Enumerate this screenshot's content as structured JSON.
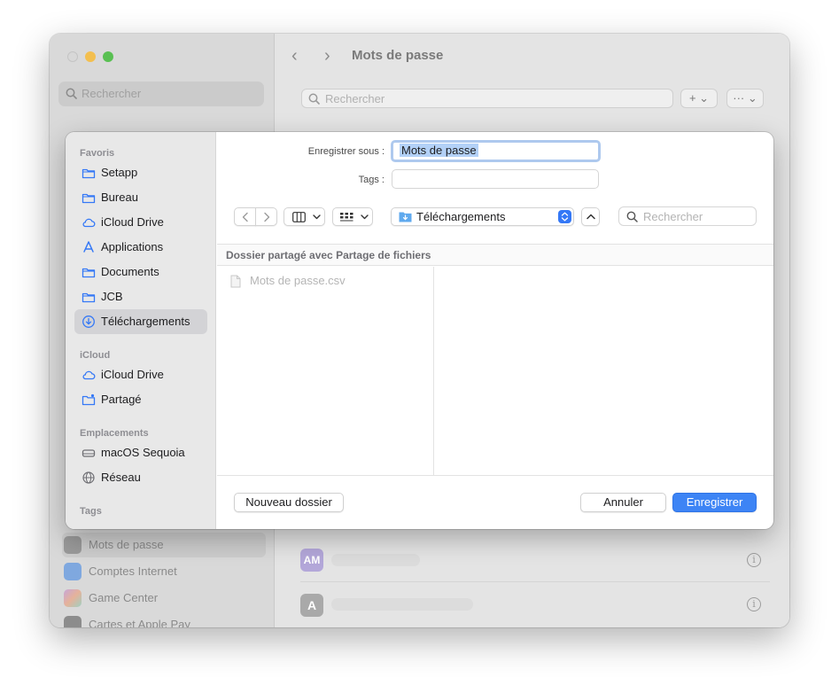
{
  "background_window": {
    "sidebar_search_placeholder": "Rechercher",
    "title": "Mots de passe",
    "toolbar_search_placeholder": "Rechercher",
    "add_button": "+ ⌄",
    "more_button": "··· ⌄",
    "sidebar_items": [
      {
        "label": "Mots de passe",
        "icon": "key-icon"
      },
      {
        "label": "Comptes Internet",
        "icon": "at-icon"
      },
      {
        "label": "Game Center",
        "icon": "game-center-icon"
      },
      {
        "label": "Cartes et Apple Pay",
        "icon": "wallet-icon"
      }
    ],
    "list_rows": [
      {
        "avatar": "AM"
      },
      {
        "avatar": "A"
      }
    ],
    "info_glyph": "i"
  },
  "sheet": {
    "save_as_label": "Enregistrer sous :",
    "save_as_value": "Mots de passe",
    "tags_label": "Tags :",
    "tags_value": "",
    "current_folder": "Téléchargements",
    "search_placeholder": "Rechercher",
    "shared_folder_header": "Dossier partagé avec Partage de fichiers",
    "files": [
      "Mots de passe.csv"
    ],
    "new_folder_button": "Nouveau dossier",
    "cancel_button": "Annuler",
    "save_button": "Enregistrer",
    "sidebar": {
      "favorites_title": "Favoris",
      "favorites": [
        {
          "label": "Setapp",
          "icon": "folder-icon"
        },
        {
          "label": "Bureau",
          "icon": "folder-icon"
        },
        {
          "label": "iCloud Drive",
          "icon": "cloud-icon"
        },
        {
          "label": "Applications",
          "icon": "applications-icon"
        },
        {
          "label": "Documents",
          "icon": "folder-icon"
        },
        {
          "label": "JCB",
          "icon": "folder-icon"
        },
        {
          "label": "Téléchargements",
          "icon": "download-icon",
          "selected": true
        }
      ],
      "icloud_title": "iCloud",
      "icloud": [
        {
          "label": "iCloud Drive",
          "icon": "cloud-icon"
        },
        {
          "label": "Partagé",
          "icon": "shared-folder-icon"
        }
      ],
      "locations_title": "Emplacements",
      "locations": [
        {
          "label": "macOS Sequoia",
          "icon": "disk-icon"
        },
        {
          "label": "Réseau",
          "icon": "globe-icon"
        }
      ],
      "tags_title": "Tags"
    }
  },
  "colors": {
    "accent": "#3d84f5",
    "icon_blue": "#3478f6",
    "sidebar_selected": "#d3d3d6"
  }
}
